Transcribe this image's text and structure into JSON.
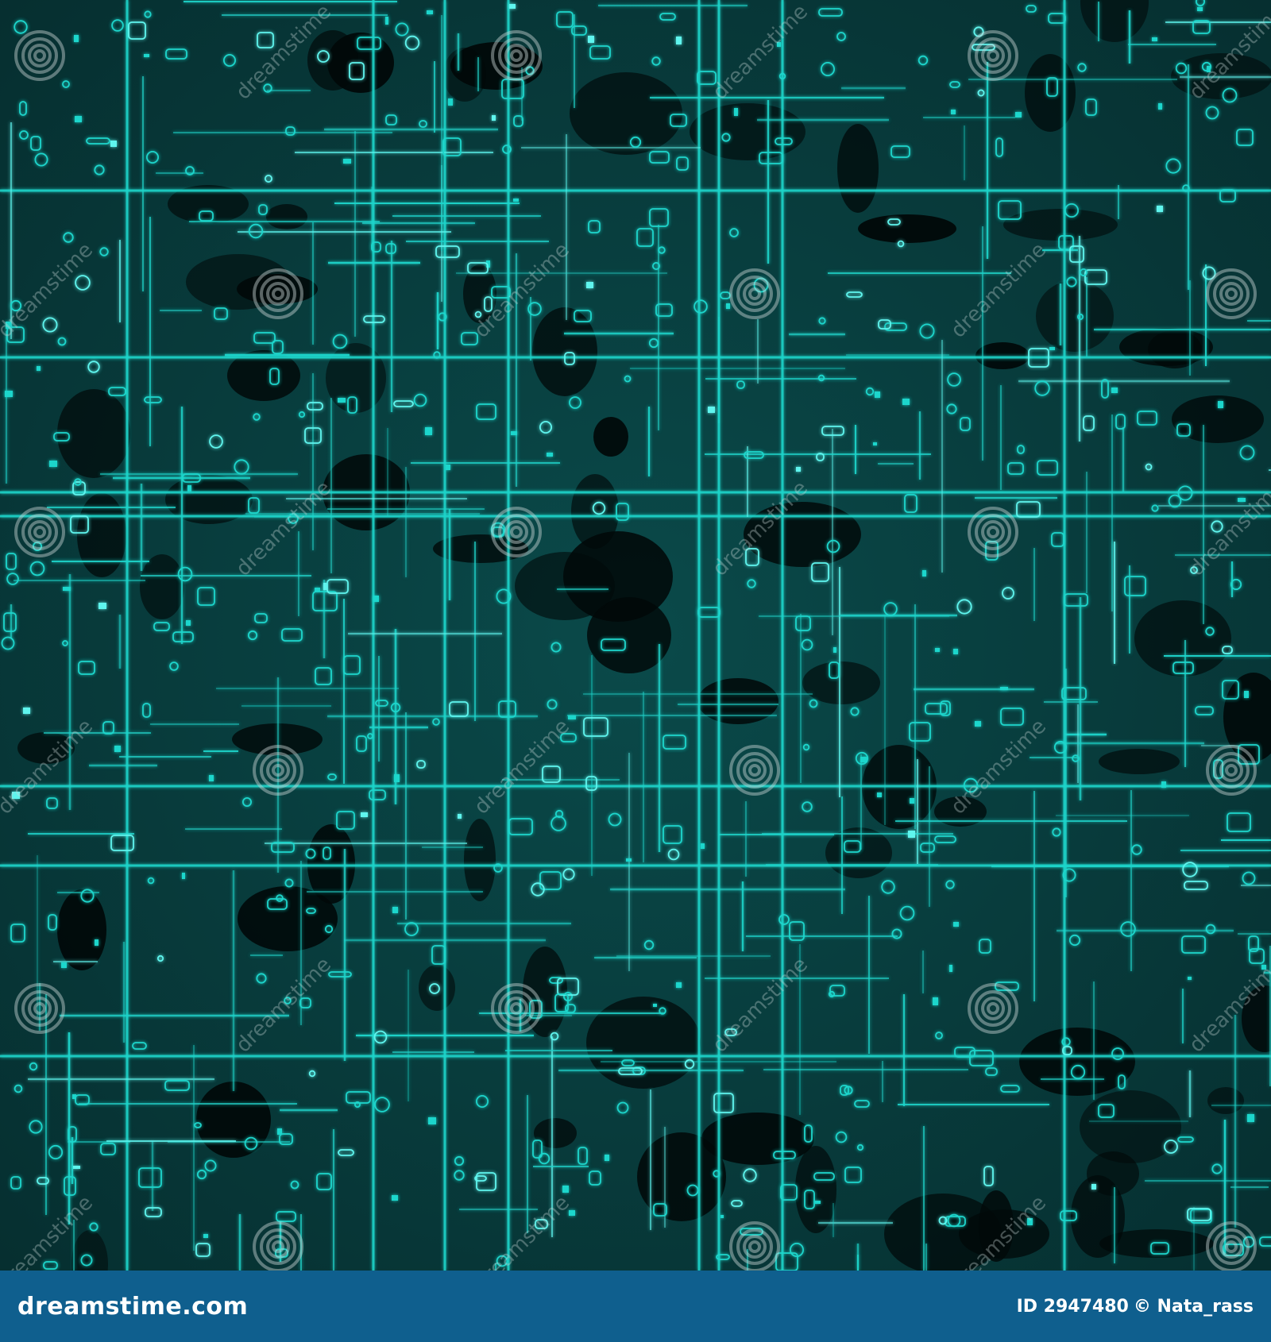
{
  "image": {
    "subject": "circuit-board-texture",
    "palette": {
      "background": "#021414",
      "trace": "#1fd6cc",
      "trace_bright": "#5ff5ee",
      "footer": "#0f5f8e"
    }
  },
  "watermark": {
    "text": "dreamstime",
    "icon": "spiral-logo-icon"
  },
  "footer": {
    "brand": "dreamstime.com",
    "id_label": "ID 2947480",
    "copyright": "© Nata_rass"
  }
}
